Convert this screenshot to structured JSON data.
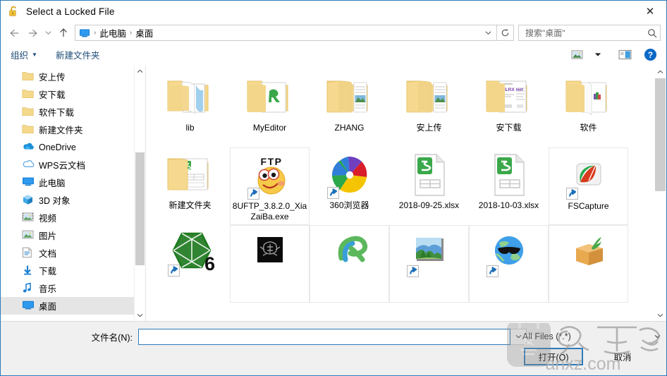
{
  "window": {
    "title": "Select a Locked File",
    "title_icon": "lock-open-icon",
    "close_label": "✕"
  },
  "addressbar": {
    "back_icon": "arrow-left-icon",
    "forward_icon": "arrow-right-icon",
    "recent_icon": "chevron-down-icon",
    "up_icon": "arrow-up-icon",
    "path_icon": "this-pc-icon",
    "crumbs": [
      "此电脑",
      "桌面"
    ],
    "separator": "›",
    "dropdown_icon": "chevron-down-icon",
    "refresh_icon": "refresh-icon",
    "search": {
      "placeholder": "搜索\"桌面\"",
      "value": "",
      "icon": "search-icon"
    }
  },
  "commandbar": {
    "organize_label": "组织",
    "organize_caret": "▼",
    "new_folder_label": "新建文件夹",
    "view_icon": "view-layout-icon",
    "view_caret": "▼",
    "preview_pane_icon": "preview-pane-icon",
    "help_icon": "help-icon"
  },
  "sidebar": {
    "scroll_up": "▲",
    "scroll_down": "▼",
    "items": [
      {
        "label": "安上传",
        "icon": "folder-icon",
        "indent": 2,
        "selected": false
      },
      {
        "label": "安下载",
        "icon": "folder-icon",
        "indent": 2,
        "selected": false
      },
      {
        "label": "软件下载",
        "icon": "folder-icon",
        "indent": 2,
        "selected": false
      },
      {
        "label": "新建文件夹",
        "icon": "folder-icon",
        "indent": 2,
        "selected": false
      },
      {
        "label": "OneDrive",
        "icon": "onedrive-icon",
        "indent": 1,
        "selected": false
      },
      {
        "label": "WPS云文档",
        "icon": "wps-cloud-icon",
        "indent": 1,
        "selected": false
      },
      {
        "label": "此电脑",
        "icon": "this-pc-icon",
        "indent": 1,
        "selected": false
      },
      {
        "label": "3D 对象",
        "icon": "3d-objects-icon",
        "indent": 2,
        "selected": false
      },
      {
        "label": "视频",
        "icon": "videos-icon",
        "indent": 2,
        "selected": false
      },
      {
        "label": "图片",
        "icon": "pictures-icon",
        "indent": 2,
        "selected": false
      },
      {
        "label": "文档",
        "icon": "documents-icon",
        "indent": 2,
        "selected": false
      },
      {
        "label": "下载",
        "icon": "downloads-icon",
        "indent": 2,
        "selected": false
      },
      {
        "label": "音乐",
        "icon": "music-icon",
        "indent": 2,
        "selected": false
      },
      {
        "label": "桌面",
        "icon": "desktop-icon",
        "indent": 2,
        "selected": true
      }
    ]
  },
  "filelist": {
    "scroll_up": "▲",
    "scroll_down": "▼",
    "items": [
      {
        "name": "lib",
        "icon": "folder-preview-icon",
        "shortcut": false,
        "boxed": false
      },
      {
        "name": "MyEditor",
        "icon": "folder-preview-resource-icon",
        "shortcut": false,
        "boxed": false
      },
      {
        "name": "ZHANG",
        "icon": "folder-preview-photo-icon",
        "shortcut": false,
        "boxed": false
      },
      {
        "name": "安上传",
        "icon": "folder-preview-photo-icon",
        "shortcut": false,
        "boxed": false
      },
      {
        "name": "安下载",
        "icon": "folder-preview-doc-icon",
        "shortcut": false,
        "boxed": false
      },
      {
        "name": "软件",
        "icon": "folder-preview-app-icon",
        "shortcut": false,
        "boxed": false
      },
      {
        "name": "新建文件夹",
        "icon": "folder-preview-sheet-icon",
        "shortcut": false,
        "boxed": false
      },
      {
        "name": "8UFTP_3.8.2.0_XiaZaiBa.exe",
        "icon": "ftp-smiley-icon",
        "shortcut": true,
        "boxed": true
      },
      {
        "name": "360浏览器",
        "icon": "360-browser-icon",
        "shortcut": true,
        "boxed": false
      },
      {
        "name": "2018-09-25.xlsx",
        "icon": "wps-spreadsheet-icon",
        "shortcut": false,
        "boxed": false
      },
      {
        "name": "2018-10-03.xlsx",
        "icon": "wps-spreadsheet-icon",
        "shortcut": false,
        "boxed": false
      },
      {
        "name": "FSCapture",
        "icon": "fscapture-icon",
        "shortcut": true,
        "boxed": true
      },
      {
        "name": "",
        "icon": "dice-6-icon",
        "shortcut": true,
        "boxed": false
      },
      {
        "name": "",
        "icon": "dark-emblem-icon",
        "shortcut": false,
        "boxed": true
      },
      {
        "name": "",
        "icon": "resource-r-icon",
        "shortcut": false,
        "boxed": true
      },
      {
        "name": "",
        "icon": "landscape-photo-icon",
        "shortcut": true,
        "boxed": true
      },
      {
        "name": "",
        "icon": "globe-sunglasses-icon",
        "shortcut": true,
        "boxed": true
      },
      {
        "name": "",
        "icon": "open-box-icon",
        "shortcut": false,
        "boxed": true
      }
    ]
  },
  "footer": {
    "filename_label": "文件名(N):",
    "filename_value": "",
    "filename_placeholder": "",
    "filetype_value": "All Files (*.*)",
    "filetype_caret": "∨",
    "filename_caret": "∨",
    "open_button": "打开(O)",
    "cancel_button": "取消"
  },
  "watermark": {
    "text_cn": "安下载",
    "text_url": "anxz.com"
  },
  "colors": {
    "accent": "#2e7ab8",
    "link": "#1b4a75",
    "folder": "#f7dc9a",
    "selected_row": "#e5e5e5",
    "footer_bg": "#f0f0f0"
  }
}
